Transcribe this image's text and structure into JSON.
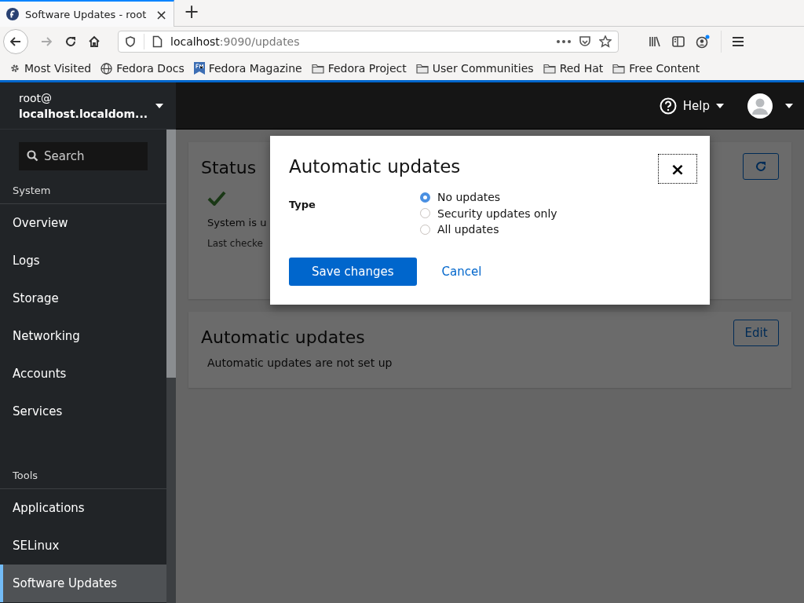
{
  "browser": {
    "tab": {
      "title": "Software Updates - root",
      "close": "×"
    },
    "new_tab": "+",
    "url": {
      "host": "localhost",
      "rest": ":9090/updates"
    },
    "bookmarks": [
      {
        "kind": "gear",
        "label": "Most Visited"
      },
      {
        "kind": "globe",
        "label": "Fedora Docs"
      },
      {
        "kind": "fm",
        "label": "Fedora Magazine"
      },
      {
        "kind": "folder",
        "label": "Fedora Project"
      },
      {
        "kind": "folder",
        "label": "User Communities"
      },
      {
        "kind": "folder",
        "label": "Red Hat"
      },
      {
        "kind": "folder",
        "label": "Free Content"
      }
    ]
  },
  "host": {
    "user": "root@",
    "name": "localhost.localdom..."
  },
  "masthead": {
    "help": "Help"
  },
  "sidebar": {
    "search": {
      "placeholder": "Search"
    },
    "sections": [
      {
        "title": "System",
        "items": [
          {
            "label": "Overview",
            "selected": false
          },
          {
            "label": "Logs",
            "selected": false
          },
          {
            "label": "Storage",
            "selected": false
          },
          {
            "label": "Networking",
            "selected": false
          },
          {
            "label": "Accounts",
            "selected": false
          },
          {
            "label": "Services",
            "selected": false
          }
        ]
      },
      {
        "title": "Tools",
        "items": [
          {
            "label": "Applications",
            "selected": false
          },
          {
            "label": "SELinux",
            "selected": false
          },
          {
            "label": "Software Updates",
            "selected": true
          }
        ]
      }
    ]
  },
  "status_card": {
    "title": "Status",
    "message": "System is u",
    "last_checked": "Last checke"
  },
  "auto_card": {
    "title": "Automatic updates",
    "edit": "Edit",
    "message": "Automatic updates are not set up"
  },
  "dialog": {
    "title": "Automatic updates",
    "close": "×",
    "field_label": "Type",
    "options": [
      {
        "label": "No updates",
        "selected": true
      },
      {
        "label": "Security updates only",
        "selected": false
      },
      {
        "label": "All updates",
        "selected": false
      }
    ],
    "save": "Save changes",
    "cancel": "Cancel"
  }
}
